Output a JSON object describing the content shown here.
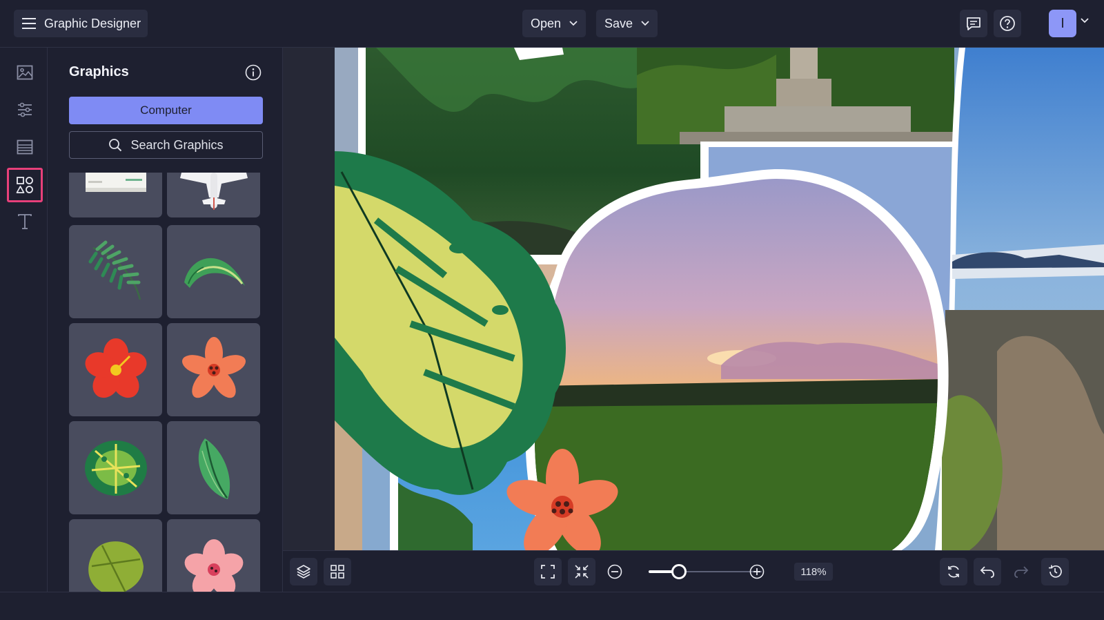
{
  "app": {
    "title": "Graphic Designer",
    "menu_icon": "hamburger-icon"
  },
  "header": {
    "open_label": "Open",
    "save_label": "Save",
    "avatar_initial": "I",
    "accent": "#7f8bf4",
    "active_highlight": "#e8407a"
  },
  "rail": {
    "items": [
      {
        "icon": "image-icon",
        "active": false
      },
      {
        "icon": "sliders-icon",
        "active": false
      },
      {
        "icon": "layout-icon",
        "active": false
      },
      {
        "icon": "shapes-icon",
        "active": true
      },
      {
        "icon": "text-icon",
        "active": false
      }
    ]
  },
  "panel": {
    "title": "Graphics",
    "computer_label": "Computer",
    "search_placeholder": "Search Graphics",
    "graphics": [
      {
        "name": "ticket-graphic"
      },
      {
        "name": "airplane-graphic"
      },
      {
        "name": "palm-frond-graphic"
      },
      {
        "name": "banana-leaf-graphic"
      },
      {
        "name": "red-hibiscus-graphic"
      },
      {
        "name": "orange-flower-graphic"
      },
      {
        "name": "monstera-leaf-graphic"
      },
      {
        "name": "green-leaf-graphic"
      },
      {
        "name": "monstera-light-graphic"
      },
      {
        "name": "pink-flower-graphic"
      }
    ]
  },
  "toolbar": {
    "zoom_label": "118%",
    "zoom_fraction": 0.27
  }
}
